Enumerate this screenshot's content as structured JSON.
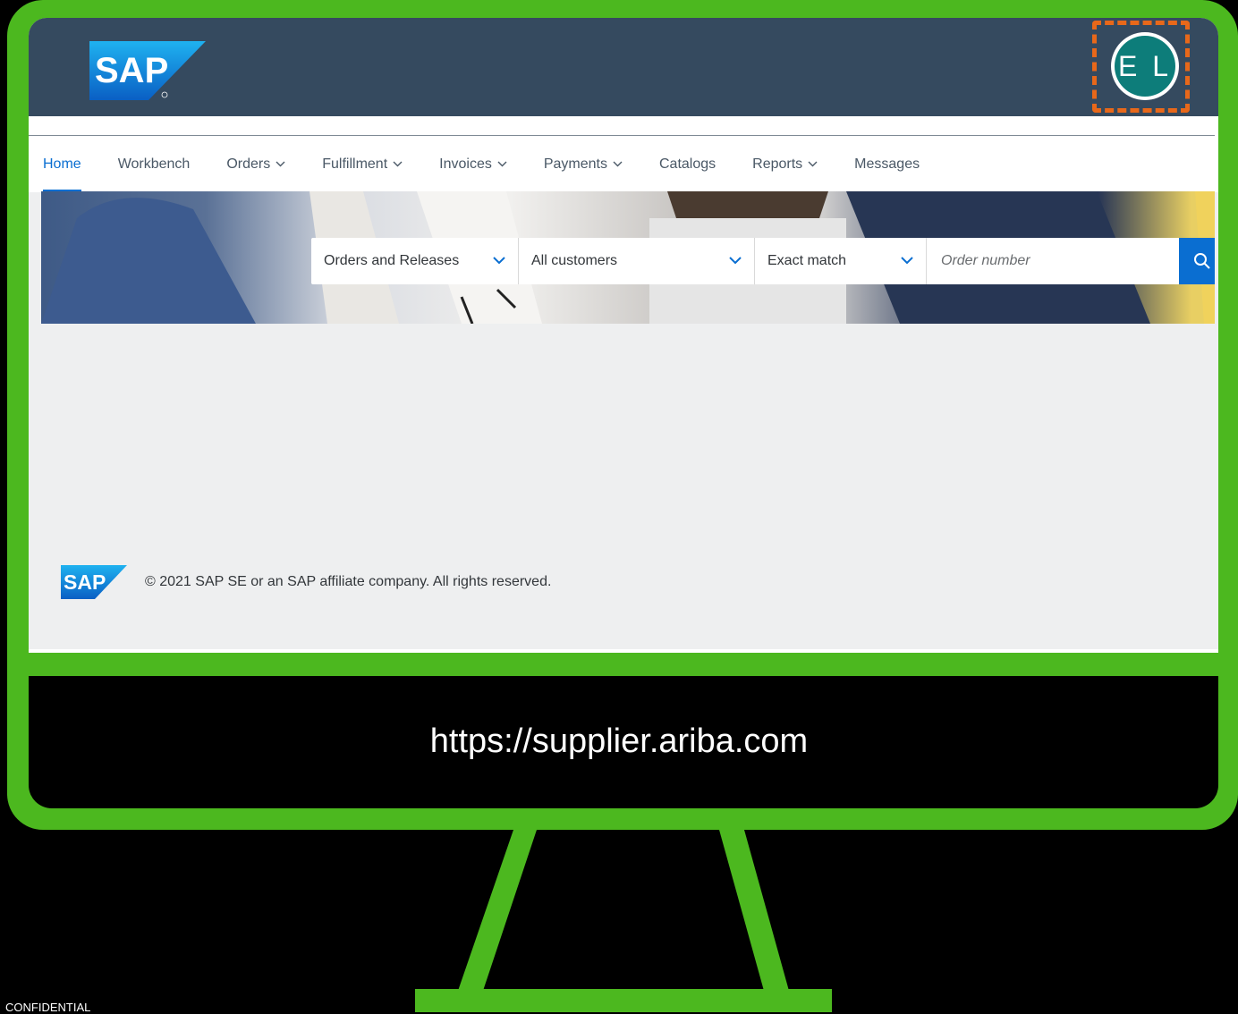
{
  "header": {
    "logo_text": "SAP",
    "avatar_initials": "E L"
  },
  "nav": {
    "items": [
      {
        "label": "Home",
        "active": true,
        "dropdown": false
      },
      {
        "label": "Workbench",
        "active": false,
        "dropdown": false
      },
      {
        "label": "Orders",
        "active": false,
        "dropdown": true
      },
      {
        "label": "Fulfillment",
        "active": false,
        "dropdown": true
      },
      {
        "label": "Invoices",
        "active": false,
        "dropdown": true
      },
      {
        "label": "Payments",
        "active": false,
        "dropdown": true
      },
      {
        "label": "Catalogs",
        "active": false,
        "dropdown": false
      },
      {
        "label": "Reports",
        "active": false,
        "dropdown": true
      },
      {
        "label": "Messages",
        "active": false,
        "dropdown": false
      }
    ]
  },
  "search": {
    "document_type": "Orders and Releases",
    "customer_filter": "All customers",
    "match_type": "Exact match",
    "placeholder": "Order number"
  },
  "footer": {
    "logo_text": "SAP",
    "copyright": "© 2021 SAP SE or an SAP affiliate company. All rights reserved."
  },
  "monitor": {
    "url": "https://supplier.ariba.com"
  },
  "slide": {
    "confidential_label": "CONFIDENTIAL"
  },
  "colors": {
    "frame_green": "#4cb81f",
    "header_bg": "#354a5f",
    "accent_blue": "#0a6ed1",
    "highlight_orange": "#e8681a",
    "avatar_teal": "#0d7d7a"
  }
}
